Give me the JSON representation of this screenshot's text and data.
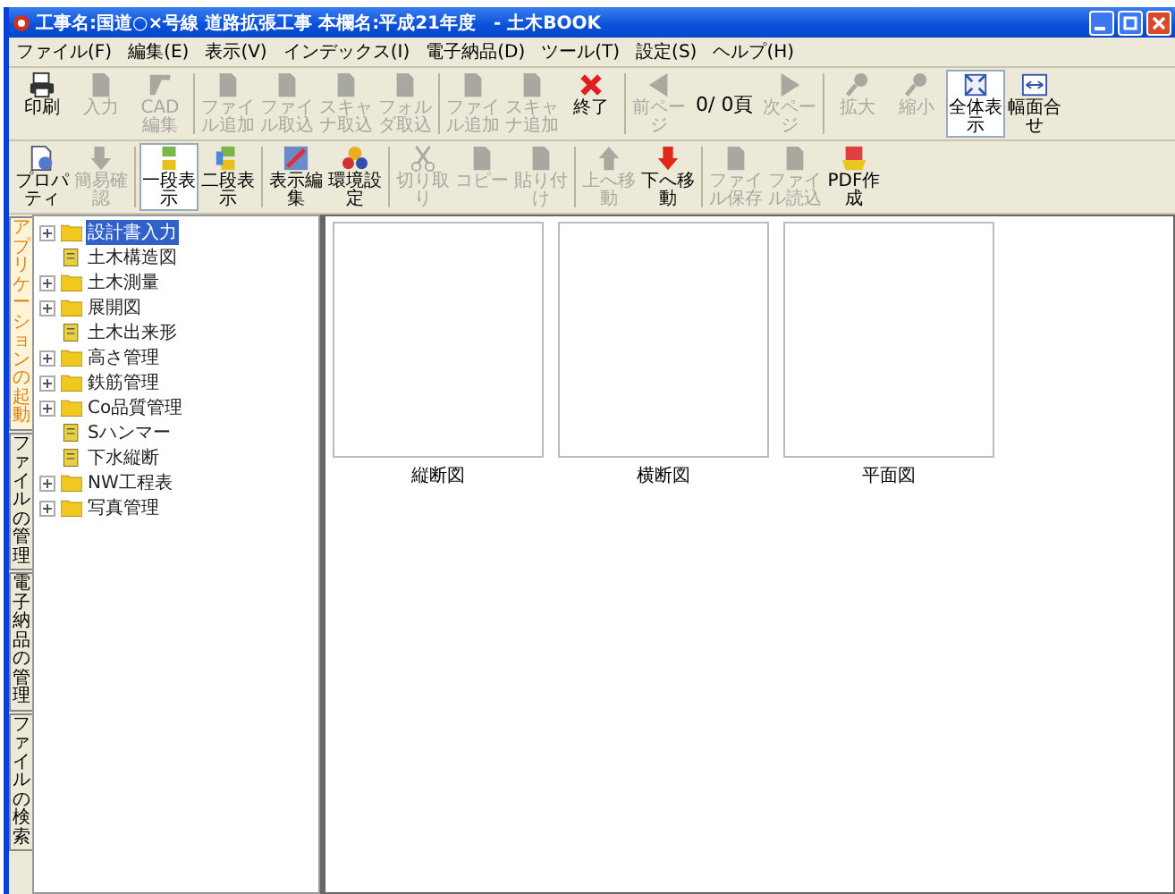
{
  "window": {
    "title": "工事名:国道○×号線 道路拡張工事 本欄名:平成21年度　- 土木BOOK"
  },
  "menu": [
    "ファイル(F)",
    "編集(E)",
    "表示(V)",
    "インデックス(I)",
    "電子納品(D)",
    "ツール(T)",
    "設定(S)",
    "ヘルプ(H)"
  ],
  "toolbar_1": [
    {
      "kind": "printer",
      "label": "印刷",
      "disabled": false
    },
    {
      "kind": "sheet",
      "label": "入力",
      "disabled": true
    },
    {
      "kind": "pencil",
      "label": "CAD編集",
      "disabled": true
    },
    {
      "kind": "sep"
    },
    {
      "kind": "sheet",
      "label": "ファイル追加",
      "disabled": true
    },
    {
      "kind": "sheet",
      "label": "ファイル取込",
      "disabled": true
    },
    {
      "kind": "sheet",
      "label": "スキャナ取込",
      "disabled": true
    },
    {
      "kind": "sheet",
      "label": "フォルダ取込",
      "disabled": true
    },
    {
      "kind": "sep"
    },
    {
      "kind": "sheet",
      "label": "ファイル追加",
      "disabled": true
    },
    {
      "kind": "sheet",
      "label": "スキャナ追加",
      "disabled": true
    },
    {
      "kind": "close",
      "label": "終了",
      "disabled": false
    },
    {
      "kind": "sep"
    },
    {
      "kind": "prev",
      "label": "前ページ",
      "disabled": true
    },
    {
      "kind": "counter",
      "label": "0/ 0頁"
    },
    {
      "kind": "next",
      "label": "次ページ",
      "disabled": true
    },
    {
      "kind": "sep"
    },
    {
      "kind": "pin",
      "label": "拡大",
      "disabled": true
    },
    {
      "kind": "pin",
      "label": "縮小",
      "disabled": true
    },
    {
      "kind": "fit",
      "label": "全体表示",
      "disabled": false,
      "selected": true
    },
    {
      "kind": "fitwidth",
      "label": "幅面合せ",
      "disabled": false,
      "selected": false
    }
  ],
  "toolbar_2": [
    {
      "kind": "props",
      "label": "プロパティ",
      "disabled": false,
      "selected": false
    },
    {
      "kind": "pointer",
      "label": "簡易確認",
      "disabled": true,
      "selected": false
    },
    {
      "kind": "sep"
    },
    {
      "kind": "layout1",
      "label": "一段表示",
      "disabled": false,
      "selected": true
    },
    {
      "kind": "layout2",
      "label": "二段表示",
      "disabled": false,
      "selected": false
    },
    {
      "kind": "sep"
    },
    {
      "kind": "edit",
      "label": "表示編集",
      "disabled": false,
      "selected": false
    },
    {
      "kind": "gear",
      "label": "環境設定",
      "disabled": false,
      "selected": false
    },
    {
      "kind": "sep"
    },
    {
      "kind": "scissors",
      "label": "切り取り",
      "disabled": true,
      "selected": false
    },
    {
      "kind": "sheet",
      "label": "コピー",
      "disabled": true,
      "selected": false
    },
    {
      "kind": "sheet",
      "label": "貼り付け",
      "disabled": true,
      "selected": false
    },
    {
      "kind": "sep"
    },
    {
      "kind": "up",
      "label": "上へ移動",
      "disabled": true,
      "selected": false
    },
    {
      "kind": "down",
      "label": "下へ移動",
      "disabled": false,
      "selected": false
    },
    {
      "kind": "sep"
    },
    {
      "kind": "sheet",
      "label": "ファイル保存",
      "disabled": true,
      "selected": false
    },
    {
      "kind": "sheet",
      "label": "ファイル読込",
      "disabled": true,
      "selected": false
    },
    {
      "kind": "pdf",
      "label": "PDF作成",
      "disabled": false,
      "selected": false
    }
  ],
  "side_tabs": [
    {
      "label": "アプリケーションの起動",
      "selected": true
    },
    {
      "label": "ファイルの管理",
      "selected": false
    },
    {
      "label": "電子納品の管理",
      "selected": false
    },
    {
      "label": "ファイルの検索",
      "selected": false
    }
  ],
  "tree": [
    {
      "kind": "folder",
      "label": "設計書入力",
      "expandable": true,
      "selected": true
    },
    {
      "kind": "document",
      "label": "土木構造図",
      "expandable": false,
      "selected": false
    },
    {
      "kind": "folder",
      "label": "土木測量",
      "expandable": true,
      "selected": false
    },
    {
      "kind": "folder",
      "label": "展開図",
      "expandable": true,
      "selected": false
    },
    {
      "kind": "document",
      "label": "土木出来形",
      "expandable": false,
      "selected": false
    },
    {
      "kind": "folder",
      "label": "高さ管理",
      "expandable": true,
      "selected": false
    },
    {
      "kind": "folder",
      "label": "鉄筋管理",
      "expandable": true,
      "selected": false
    },
    {
      "kind": "folder",
      "label": "Co品質管理",
      "expandable": true,
      "selected": false
    },
    {
      "kind": "document",
      "label": "Sハンマー",
      "expandable": false,
      "selected": false
    },
    {
      "kind": "document",
      "label": "下水縦断",
      "expandable": false,
      "selected": false
    },
    {
      "kind": "folder",
      "label": "NW工程表",
      "expandable": true,
      "selected": false
    },
    {
      "kind": "folder",
      "label": "写真管理",
      "expandable": true,
      "selected": false
    }
  ],
  "thumbnails": [
    {
      "label": "縦断図"
    },
    {
      "label": "横断図"
    },
    {
      "label": "平面図"
    }
  ]
}
